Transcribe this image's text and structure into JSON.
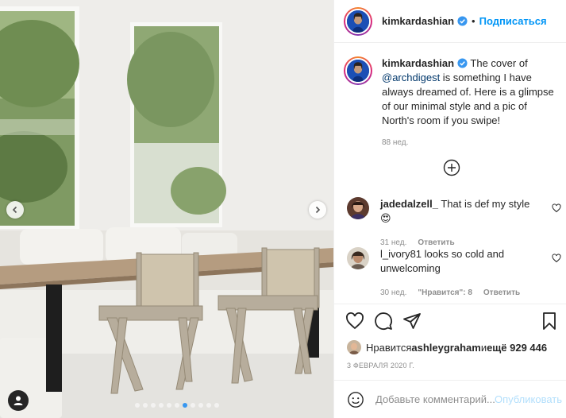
{
  "post": {
    "username": "kimkardashian",
    "follow_label": "Подписаться",
    "separator": "•",
    "caption_mention": "@archdigest",
    "caption_before": " The cover of ",
    "caption_after": " is something I have always dreamed of. Here is a glimpse of our minimal style and a pic of North's room if you swipe!",
    "caption_time": "88 нед.",
    "photo_slide_count": 11,
    "photo_active_slide": 7
  },
  "comments": [
    {
      "username": "jadedalzell_",
      "text": " That is def my style 😍",
      "time": "31 нед.",
      "reply_label": "Ответить",
      "likes_label": ""
    },
    {
      "username": "l_ivory81",
      "text": " looks so cold and unwelcoming",
      "time": "30 нед.",
      "likes_label": "\"Нравится\": 8",
      "reply_label": "Ответить"
    }
  ],
  "likes": {
    "prefix": "Нравится ",
    "user": "ashleygraham",
    "middle": " и ",
    "count": "ещё 929 446"
  },
  "date": "3 ФЕВРАЛЯ 2020 Г.",
  "add_comment": {
    "placeholder": "Добавьте комментарий...",
    "post_label": "Опубликовать"
  },
  "icons": {
    "verified": "verified-badge-icon",
    "more": "plus-circle-icon",
    "like": "heart-icon",
    "comment": "comment-bubble-icon",
    "share": "paper-plane-icon",
    "save": "bookmark-icon",
    "emoji": "smiley-icon",
    "tag": "user-tag-icon"
  },
  "colors": {
    "link_blue": "#0095f6",
    "mention": "#00376b",
    "muted": "#8e8e8e",
    "post_disabled": "#b2dffc",
    "active_dot": "#3897f0"
  }
}
